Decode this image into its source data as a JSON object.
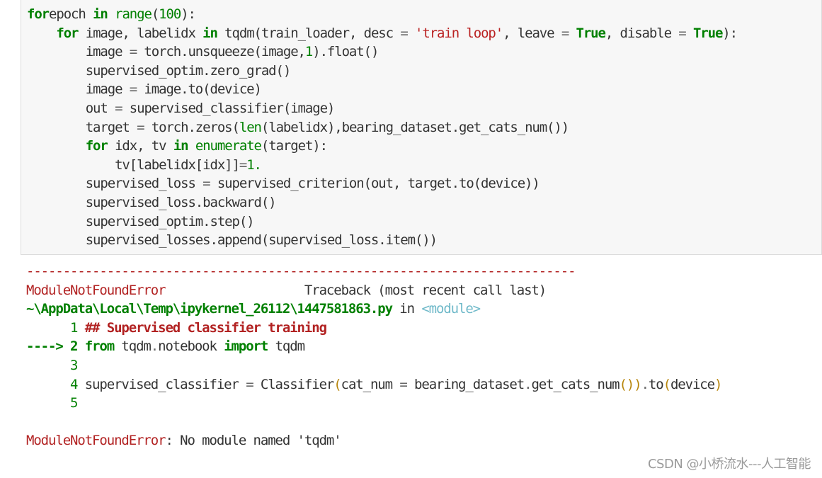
{
  "code_cell": {
    "lines": [
      {
        "t": [
          [
            "kw",
            "for"
          ],
          [
            "",
            "epoch "
          ],
          [
            "kw",
            "in"
          ],
          [
            "",
            " "
          ],
          [
            "bi",
            "range"
          ],
          [
            "",
            "("
          ],
          [
            "num",
            "100"
          ],
          [
            "",
            "):"
          ]
        ]
      },
      {
        "t": [
          [
            "",
            "    "
          ],
          [
            "kw",
            "for"
          ],
          [
            "",
            " image, labelidx "
          ],
          [
            "kw",
            "in"
          ],
          [
            "",
            " tqdm(train_loader, desc "
          ],
          [
            "op",
            "="
          ],
          [
            "",
            " "
          ],
          [
            "str",
            "'train loop'"
          ],
          [
            "",
            ", leave "
          ],
          [
            "op",
            "="
          ],
          [
            "",
            " "
          ],
          [
            "kw",
            "True"
          ],
          [
            "",
            ", disable "
          ],
          [
            "op",
            "="
          ],
          [
            "",
            " "
          ],
          [
            "kw",
            "True"
          ],
          [
            "",
            "):"
          ]
        ]
      },
      {
        "t": [
          [
            "",
            "        image "
          ],
          [
            "op",
            "="
          ],
          [
            "",
            " torch.unsqueeze(image,"
          ],
          [
            "num",
            "1"
          ],
          [
            "",
            ").float()"
          ]
        ]
      },
      {
        "t": [
          [
            "",
            "        supervised_optim.zero_grad()"
          ]
        ]
      },
      {
        "t": [
          [
            "",
            "        image "
          ],
          [
            "op",
            "="
          ],
          [
            "",
            " image.to(device)"
          ]
        ]
      },
      {
        "t": [
          [
            "",
            "        out "
          ],
          [
            "op",
            "="
          ],
          [
            "",
            " supervised_classifier(image)"
          ]
        ]
      },
      {
        "t": [
          [
            "",
            "        target "
          ],
          [
            "op",
            "="
          ],
          [
            "",
            " torch.zeros("
          ],
          [
            "bi",
            "len"
          ],
          [
            "",
            "(labelidx),bearing_dataset.get_cats_num())"
          ]
        ]
      },
      {
        "t": [
          [
            "",
            "        "
          ],
          [
            "kw",
            "for"
          ],
          [
            "",
            " idx, tv "
          ],
          [
            "kw",
            "in"
          ],
          [
            "",
            " "
          ],
          [
            "bi",
            "enumerate"
          ],
          [
            "",
            "(target):"
          ]
        ]
      },
      {
        "t": [
          [
            "",
            "            tv[labelidx[idx]]"
          ],
          [
            "op",
            "="
          ],
          [
            "num",
            "1."
          ]
        ]
      },
      {
        "t": [
          [
            "",
            "        supervised_loss "
          ],
          [
            "op",
            "="
          ],
          [
            "",
            " supervised_criterion(out, target.to(device))"
          ]
        ]
      },
      {
        "t": [
          [
            "",
            "        supervised_loss.backward()"
          ]
        ]
      },
      {
        "t": [
          [
            "",
            "        supervised_optim.step()"
          ]
        ]
      },
      {
        "t": [
          [
            "",
            "        supervised_losses.append(supervised_loss.item())"
          ]
        ]
      }
    ]
  },
  "traceback": {
    "separator": "---------------------------------------------------------------------------",
    "header_error": "ModuleNotFoundError",
    "header_traceback": "Traceback (most recent call last)",
    "file_path": "~\\AppData\\Local\\Temp\\ipykernel_26112\\1447581863.py",
    "in_text": " in ",
    "module_text": "<module>",
    "lines": [
      {
        "t": [
          [
            "lineno",
            "      1 "
          ],
          [
            "cmt",
            "## Supervised classifier training"
          ]
        ]
      },
      {
        "t": [
          [
            "arrow",
            "----> 2 "
          ],
          [
            "kw",
            "from"
          ],
          [
            "",
            " tqdm"
          ],
          [
            "op",
            "."
          ],
          [
            "",
            "notebook "
          ],
          [
            "kw",
            "import"
          ],
          [
            "",
            " tqdm"
          ]
        ]
      },
      {
        "t": [
          [
            "lineno",
            "      3"
          ]
        ]
      },
      {
        "t": [
          [
            "lineno",
            "      4 "
          ],
          [
            "",
            "supervised_classifier "
          ],
          [
            "op",
            "="
          ],
          [
            "",
            " Classifier"
          ],
          [
            "paren",
            "("
          ],
          [
            "",
            "cat_num "
          ],
          [
            "op",
            "="
          ],
          [
            "",
            " bearing_dataset"
          ],
          [
            "op",
            "."
          ],
          [
            "",
            "get_cats_num"
          ],
          [
            "paren",
            "())"
          ],
          [
            "op",
            "."
          ],
          [
            "",
            "to"
          ],
          [
            "paren",
            "("
          ],
          [
            "",
            "device"
          ],
          [
            "paren",
            ")"
          ]
        ]
      },
      {
        "t": [
          [
            "lineno",
            "      5"
          ]
        ]
      },
      {
        "t": [
          [
            "",
            ""
          ]
        ]
      }
    ],
    "final_error": "ModuleNotFoundError",
    "final_message": ": No module named 'tqdm'"
  },
  "watermark": "CSDN @小桥流水---人工智能"
}
